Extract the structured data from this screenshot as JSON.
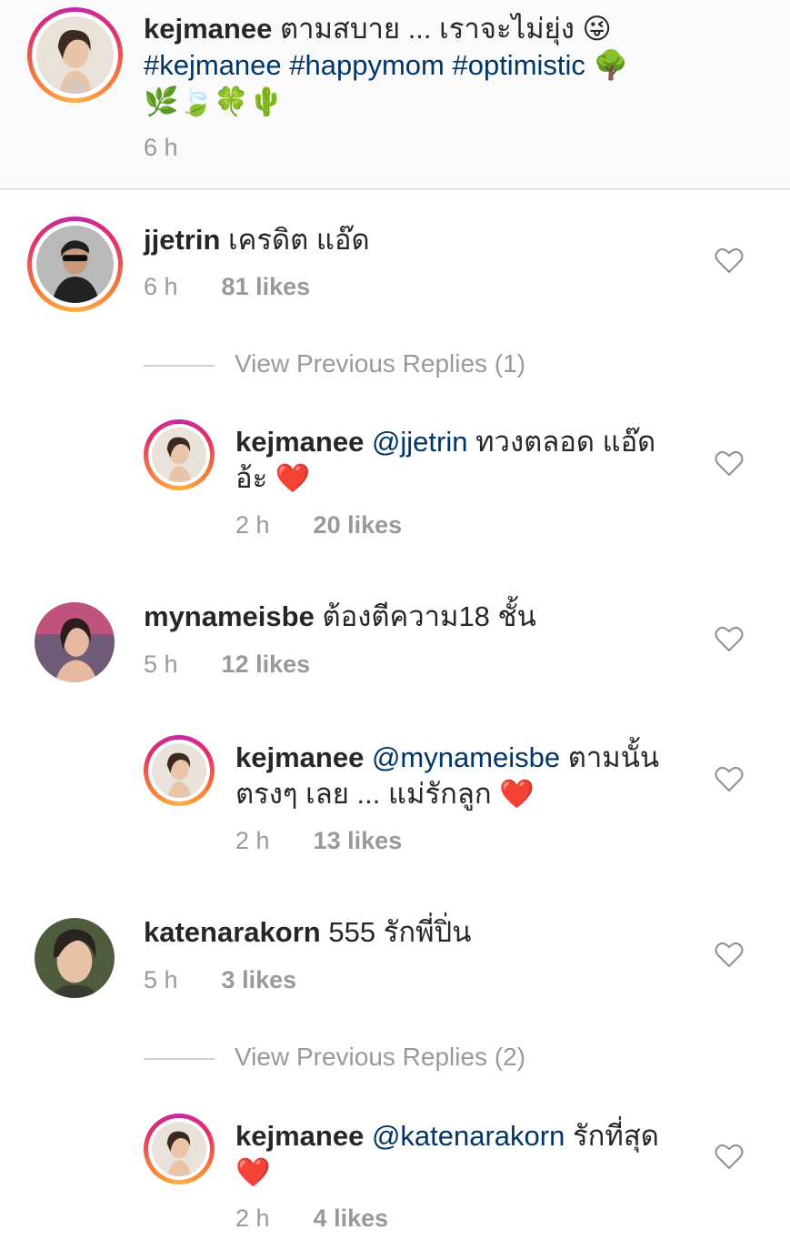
{
  "caption": {
    "username": "kejmanee",
    "text": " ตามสบาย ... เราจะไม่ยุ่ง 😜",
    "hashtags": "#kejmanee #happymom #optimistic",
    "emoji_line1": " 🌳",
    "emoji_line2": "🌿🍃🍀🌵",
    "time": "6 h"
  },
  "comments": [
    {
      "username": "jjetrin",
      "text": " เครดิต แอ๊ด",
      "time": "6 h",
      "likes": "81 likes"
    },
    {
      "view_replies": "View Previous Replies (1)"
    },
    {
      "username": "kejmanee",
      "mention": " @jjetrin",
      "text": " ทวงตลอด แอ๊ด",
      "text_line2": "อ้ะ ",
      "emoji": "❤️",
      "time": "2 h",
      "likes": "20 likes"
    },
    {
      "username": "mynameisbe",
      "text": " ต้องตีความ18 ชั้น",
      "time": "5 h",
      "likes": "12 likes"
    },
    {
      "username": "kejmanee",
      "mention": " @mynameisbe",
      "text": " ตามนั้น",
      "text_line2": "ตรงๆ เลย ... แม่รักลูก ",
      "emoji": "❤️",
      "time": "2 h",
      "likes": "13 likes"
    },
    {
      "username": "katenarakorn",
      "text": " 555 รักพี่ปิ่น",
      "time": "5 h",
      "likes": "3 likes"
    },
    {
      "view_replies": "View Previous Replies (2)"
    },
    {
      "username": "kejmanee",
      "mention": " @katenarakorn",
      "text": " รักที่สุด",
      "emoji": "❤️",
      "time": "2 h",
      "likes": "4 likes"
    }
  ],
  "icons": {
    "like": "heart-outline-icon"
  },
  "colors": {
    "mention": "#003569",
    "meta": "#999999",
    "heart": "#e0141c",
    "story_ring_start": "#c32aa3",
    "story_ring_end": "#fcaf45"
  }
}
